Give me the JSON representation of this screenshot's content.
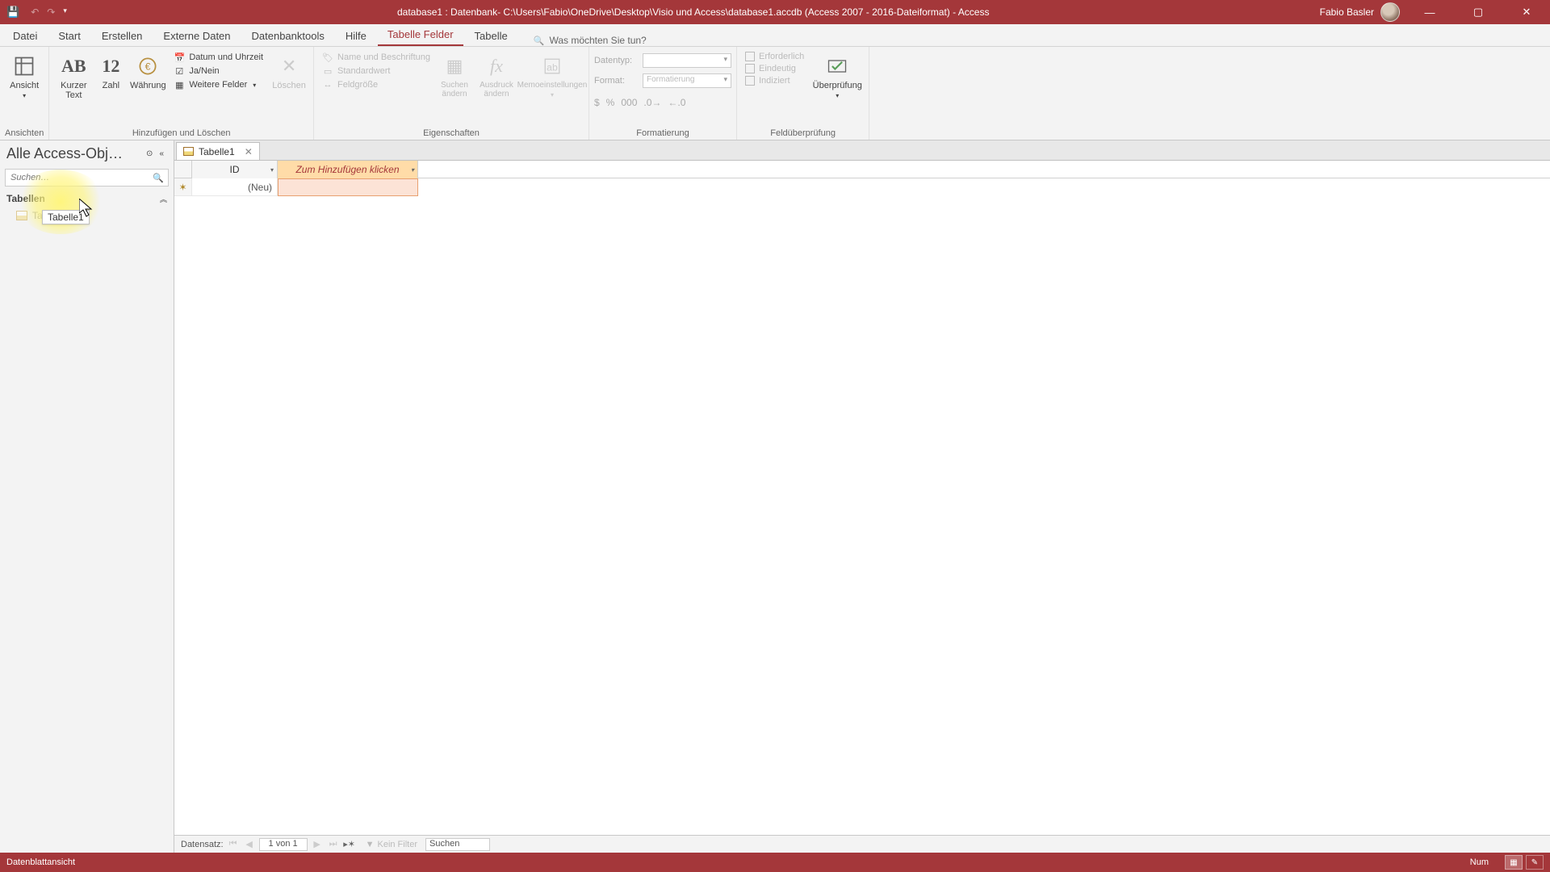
{
  "titlebar": {
    "title": "database1 : Datenbank- C:\\Users\\Fabio\\OneDrive\\Desktop\\Visio und Access\\database1.accdb (Access 2007 - 2016-Dateiformat) - Access",
    "user": "Fabio Basler"
  },
  "tabs": {
    "items": [
      "Datei",
      "Start",
      "Erstellen",
      "Externe Daten",
      "Datenbanktools",
      "Hilfe",
      "Tabelle Felder",
      "Tabelle"
    ],
    "active": "Tabelle Felder",
    "tell_me": "Was möchten Sie tun?"
  },
  "ribbon": {
    "g1": {
      "ansicht": "Ansicht",
      "label": "Ansichten"
    },
    "g2": {
      "kurzer_text": "Kurzer Text",
      "zahl": "Zahl",
      "waehrung": "Währung",
      "datum": "Datum und Uhrzeit",
      "janein": "Ja/Nein",
      "weitere": "Weitere Felder",
      "loeschen": "Löschen",
      "label": "Hinzufügen und Löschen"
    },
    "g3": {
      "name_beschr": "Name und Beschriftung",
      "standard": "Standardwert",
      "feldgroesse": "Feldgröße",
      "suchen": "Suchen ändern",
      "ausdruck": "Ausdruck ändern",
      "memo": "Memoeinstellungen",
      "label": "Eigenschaften"
    },
    "g4": {
      "datentyp_lbl": "Datentyp:",
      "format_lbl": "Format:",
      "format_ph": "Formatierung",
      "label": "Formatierung"
    },
    "g5": {
      "erforderlich": "Erforderlich",
      "eindeutig": "Eindeutig",
      "indiziert": "Indiziert",
      "ueberpruefung": "Überprüfung",
      "label": "Feldüberprüfung"
    }
  },
  "navpane": {
    "header": "Alle Access-Obj…",
    "search_ph": "Suchen…",
    "group": "Tabellen",
    "items": [
      "Tabelle1"
    ],
    "tooltip": "Tabelle1"
  },
  "doc": {
    "tab": "Tabelle1",
    "col_id": "ID",
    "col_add": "Zum Hinzufügen klicken",
    "new_row": "(Neu)"
  },
  "recordnav": {
    "label": "Datensatz:",
    "pos": "1 von 1",
    "nofilter": "Kein Filter",
    "search": "Suchen"
  },
  "statusbar": {
    "view": "Datenblattansicht",
    "num": "Num"
  }
}
